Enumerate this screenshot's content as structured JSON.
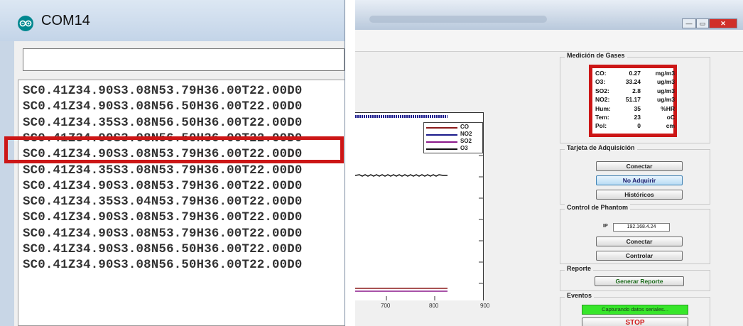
{
  "serial_monitor": {
    "title": "COM14",
    "send_value": "",
    "lines": [
      "SC0.41Z34.90S3.08N53.79H36.00T22.00D0",
      "SC0.41Z34.90S3.08N56.50H36.00T22.00D0",
      "SC0.41Z34.35S3.08N56.50H36.00T22.00D0",
      "SC0.41Z34.90S3.08N56.50H36.00T22.00D0",
      "SC0.41Z34.90S3.08N53.79H36.00T22.00D0",
      "SC0.41Z34.35S3.08N53.79H36.00T22.00D0",
      "SC0.41Z34.90S3.08N53.79H36.00T22.00D0",
      "SC0.41Z34.35S3.04N53.79H36.00T22.00D0",
      "SC0.41Z34.90S3.08N53.79H36.00T22.00D0",
      "SC0.41Z34.90S3.08N53.79H36.00T22.00D0",
      "SC0.41Z34.90S3.08N56.50H36.00T22.00D0",
      "SC0.41Z34.90S3.08N56.50H36.00T22.00D0"
    ],
    "highlighted_line_index": 3,
    "colors": {
      "highlight": "#cc1616",
      "logo": "#00878f"
    }
  },
  "app": {
    "window_buttons": {
      "minimize": "—",
      "maximize": "▭",
      "close": "✕"
    },
    "plot": {
      "legend": [
        "CO",
        "NO2",
        "SO2",
        "O3"
      ],
      "legend_colors": [
        "#8b1a1a",
        "#1a1a8b",
        "#8b1a8b",
        "#111111"
      ],
      "x_ticks": [
        "700",
        "800",
        "900"
      ]
    },
    "medicion": {
      "title": "Medición de Gases",
      "rows": [
        {
          "name": "CO:",
          "value": "0.27",
          "unit": "mg/m3"
        },
        {
          "name": "O3:",
          "value": "33.24",
          "unit": "ug/m3"
        },
        {
          "name": "SO2:",
          "value": "2.8",
          "unit": "ug/m3"
        },
        {
          "name": "NO2:",
          "value": "51.17",
          "unit": "ug/m3"
        },
        {
          "name": "Hum:",
          "value": "35",
          "unit": "%HR"
        },
        {
          "name": "Tem:",
          "value": "23",
          "unit": "oC"
        },
        {
          "name": "Pol:",
          "value": "0",
          "unit": "cm"
        }
      ]
    },
    "tarjeta": {
      "title": "Tarjeta de Adquisición",
      "buttons": [
        "Conectar",
        "No Adquirir",
        "Históricos"
      ],
      "selected_button_index": 1
    },
    "phantom": {
      "title": "Control de Phantom",
      "ip_label": "IP",
      "ip_value": "192.168.4.24",
      "buttons": [
        "Conectar",
        "Controlar"
      ]
    },
    "reporte": {
      "title": "Reporte",
      "button": "Generar Reporte"
    },
    "eventos": {
      "title": "Eventos",
      "status": "Capturando datos seriales...",
      "stop": "STOP",
      "status_color": "#37e62a"
    }
  }
}
